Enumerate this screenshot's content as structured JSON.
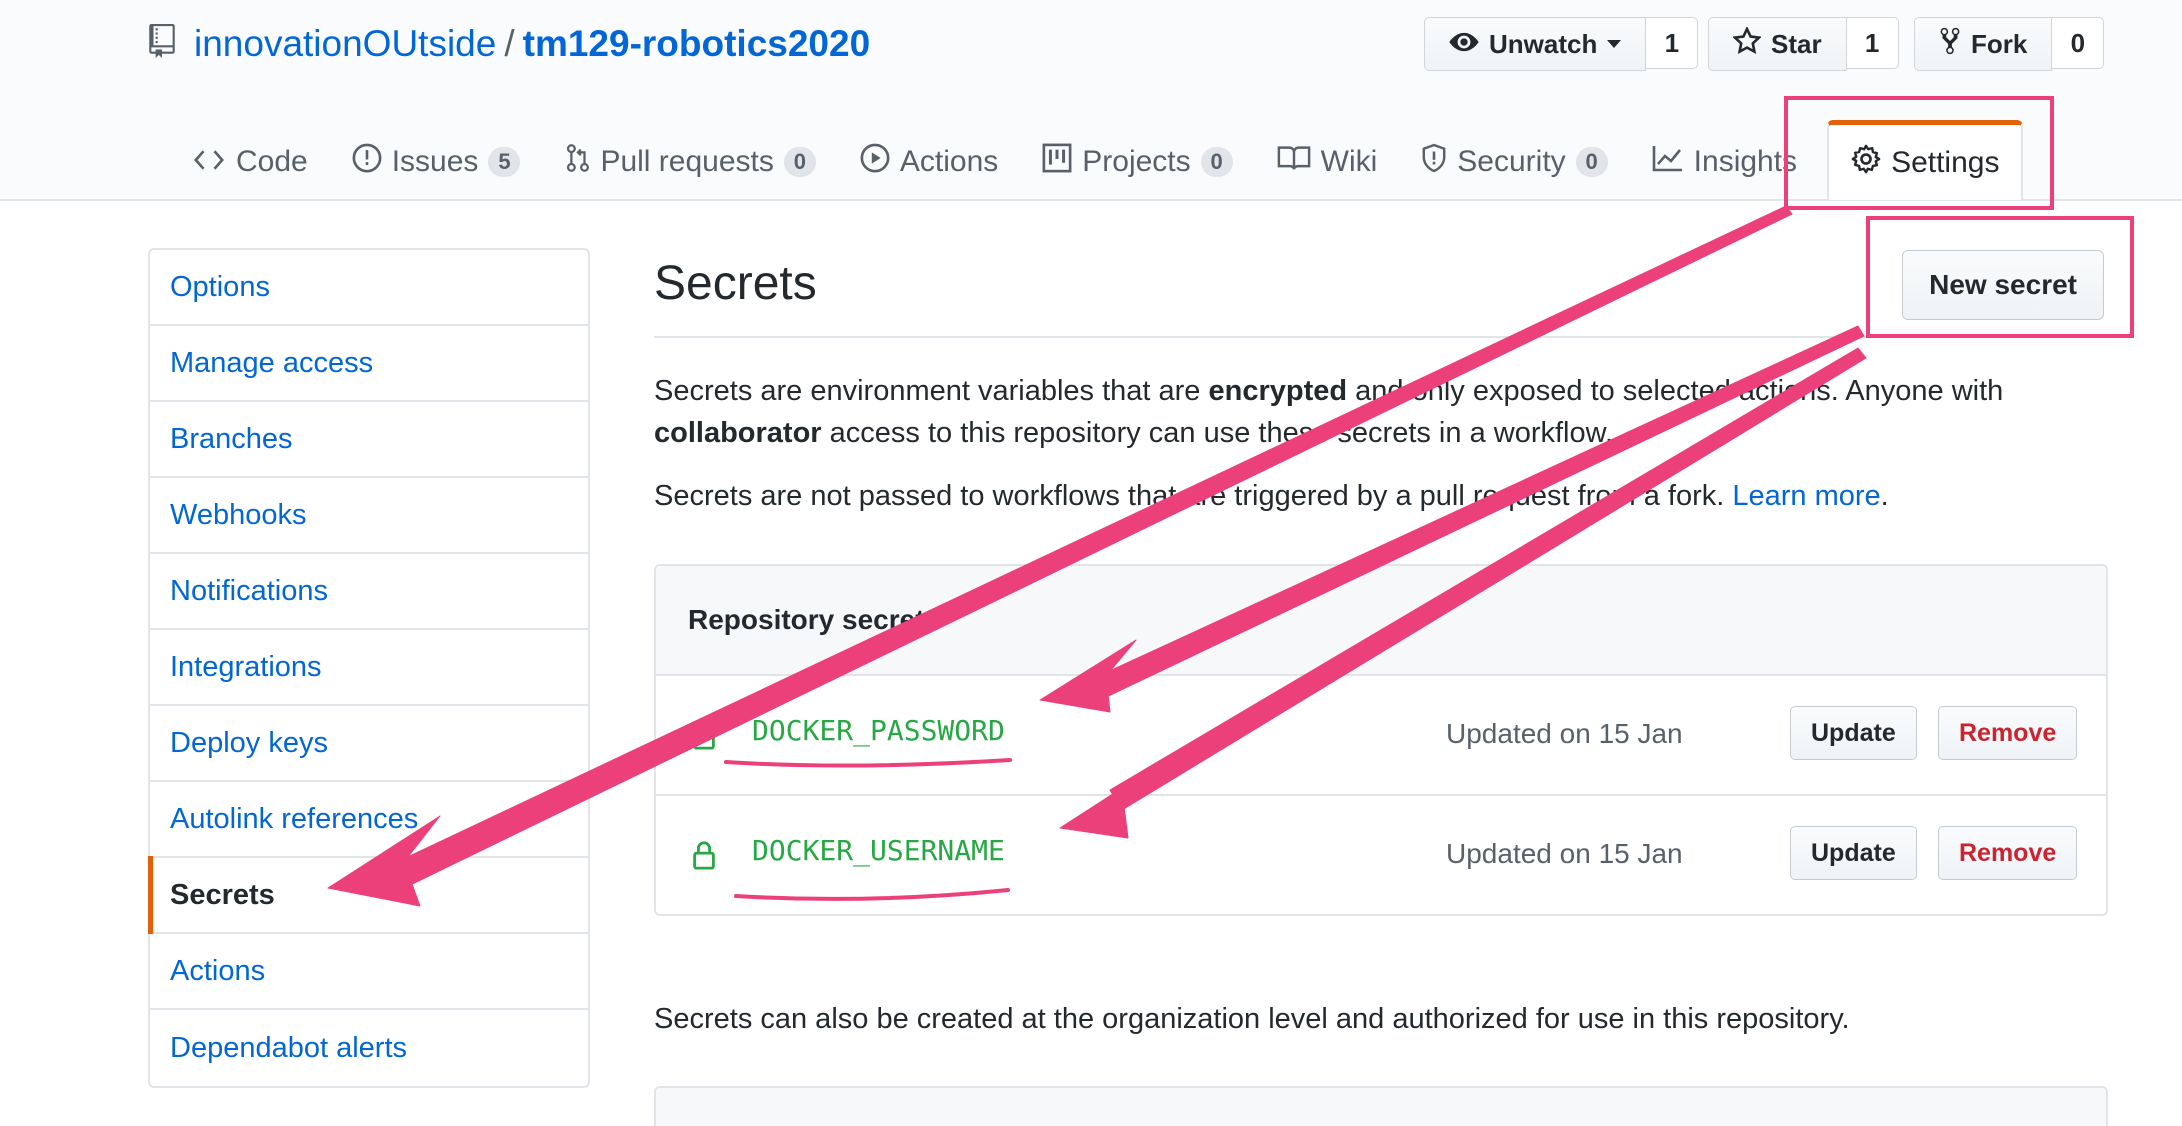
{
  "repo": {
    "owner": "innovationOUtside",
    "separator": "/",
    "name": "tm129-robotics2020"
  },
  "actions": {
    "watch": {
      "label": "Unwatch",
      "count": "1"
    },
    "star": {
      "label": "Star",
      "count": "1"
    },
    "fork": {
      "label": "Fork",
      "count": "0"
    }
  },
  "tabs": [
    {
      "label": "Code",
      "counter": ""
    },
    {
      "label": "Issues",
      "counter": "5"
    },
    {
      "label": "Pull requests",
      "counter": "0"
    },
    {
      "label": "Actions",
      "counter": ""
    },
    {
      "label": "Projects",
      "counter": "0"
    },
    {
      "label": "Wiki",
      "counter": ""
    },
    {
      "label": "Security",
      "counter": "0"
    },
    {
      "label": "Insights",
      "counter": ""
    },
    {
      "label": "Settings",
      "counter": "",
      "selected": true
    }
  ],
  "sidebar": {
    "items": [
      {
        "label": "Options"
      },
      {
        "label": "Manage access"
      },
      {
        "label": "Branches"
      },
      {
        "label": "Webhooks"
      },
      {
        "label": "Notifications"
      },
      {
        "label": "Integrations"
      },
      {
        "label": "Deploy keys"
      },
      {
        "label": "Autolink references"
      },
      {
        "label": "Secrets",
        "selected": true
      },
      {
        "label": "Actions"
      },
      {
        "label": "Dependabot alerts"
      }
    ]
  },
  "main": {
    "title": "Secrets",
    "new_secret_label": "New secret",
    "intro": {
      "p1_a": "Secrets are environment variables that are ",
      "p1_b": "encrypted",
      "p1_c": " and only exposed to selected actions. Anyone with",
      "p1_d": "collaborator",
      "p1_e": " access to this repository can use these secrets in a workflow.",
      "p2_a": "Secrets are not passed to workflows that are triggered by a pull request from a fork. ",
      "p2_link": "Learn more",
      "p2_end": "."
    },
    "repo_secrets_header": "Repository secrets",
    "secrets": [
      {
        "name": "DOCKER_PASSWORD",
        "updated": "Updated on 15 Jan",
        "update_label": "Update",
        "remove_label": "Remove"
      },
      {
        "name": "DOCKER_USERNAME",
        "updated": "Updated on 15 Jan",
        "update_label": "Update",
        "remove_label": "Remove"
      }
    ],
    "org_note": "Secrets can also be created at the organization level and authorized for use in this repository."
  },
  "annotation_color": "#ec407a",
  "accent_color": "#e36209",
  "link_color": "#0366d6"
}
